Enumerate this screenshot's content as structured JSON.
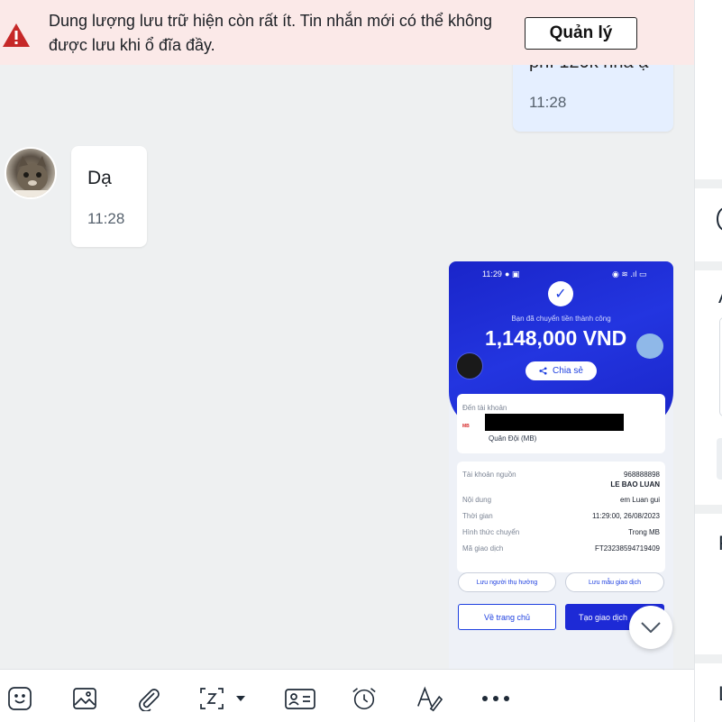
{
  "banner": {
    "message": "Dung lượng lưu trữ hiện còn rất ít. Tin nhắn mới có thể không được lưu khi ổ đĩa đầy.",
    "manage_label": "Quản lý"
  },
  "messages": {
    "sent_partial_text": "phí 120k nha ạ",
    "sent_time": "11:28",
    "received_text": "Dạ",
    "received_time": "11:28"
  },
  "transfer_image": {
    "status_time": "11:29",
    "success_text": "Bạn đã chuyển tiền thành công",
    "amount": "1,148,000 VND",
    "share_label": "Chia sẻ",
    "to_account_label": "Đến tài khoản",
    "bank_logo": "MB",
    "bank_name": "Quân Đội (MB)",
    "details": [
      {
        "key": "Tài khoản nguồn",
        "value": "968888898",
        "value2": "LE BAO LUAN"
      },
      {
        "key": "Nội dung",
        "value": "em Luan gui"
      },
      {
        "key": "Thời gian",
        "value": "11:29:00, 26/08/2023"
      },
      {
        "key": "Hình thức chuyển",
        "value": "Trong MB"
      },
      {
        "key": "Mã giao dịch",
        "value": "FT23238594719409"
      }
    ],
    "save_beneficiary_label": "Lưu người thụ hưởng",
    "save_template_label": "Lưu mẫu giao dịch",
    "home_label": "Về trang chủ",
    "new_transaction_label": "Tạo giao dịch"
  },
  "toolbar": {
    "icons": [
      "sticker-icon",
      "image-icon",
      "attachment-icon",
      "screenshot-icon",
      "contact-card-icon",
      "reminder-icon",
      "text-format-icon",
      "more-icon"
    ]
  },
  "right_panel": {
    "letters": [
      "A",
      "F",
      "L"
    ]
  },
  "colors": {
    "warning_red": "#c62828",
    "banner_bg": "#fbe9e8",
    "sent_bubble": "#e5efff",
    "bank_blue": "#1d2ad6"
  }
}
